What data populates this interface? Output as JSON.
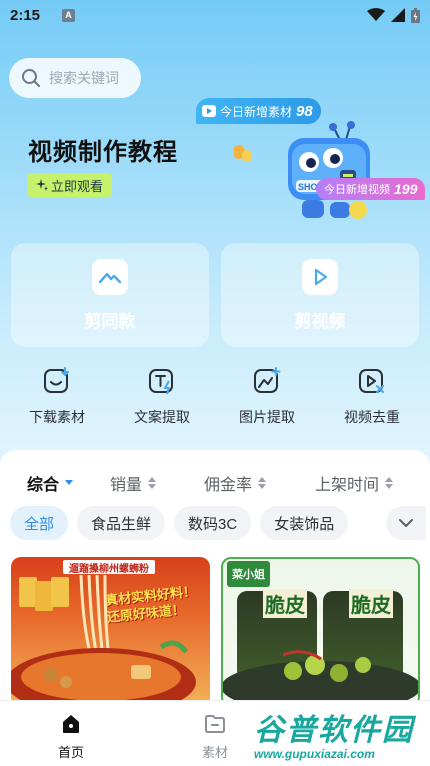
{
  "status_bar": {
    "time": "2:15",
    "notification_glyph": "A"
  },
  "search": {
    "placeholder": "搜索关键词"
  },
  "banner": {
    "title": "视频制作教程",
    "watch_button": "立即观看",
    "materials_label": "今日新增素材",
    "materials_count": "98",
    "videos_label": "今日新增视频",
    "videos_count": "199",
    "mascot_text": "SHOW"
  },
  "cards": [
    {
      "label": "剪同款",
      "icon": "mountain-icon"
    },
    {
      "label": "剪视频",
      "icon": "play-icon"
    }
  ],
  "tools": [
    {
      "label": "下载素材",
      "icon": "download-smile-icon"
    },
    {
      "label": "文案提取",
      "icon": "text-extract-icon"
    },
    {
      "label": "图片提取",
      "icon": "image-extract-icon"
    },
    {
      "label": "视频去重",
      "icon": "video-dedupe-icon"
    }
  ],
  "sort": [
    {
      "label": "综合",
      "active": true
    },
    {
      "label": "销量",
      "active": false
    },
    {
      "label": "佣金率",
      "active": false
    },
    {
      "label": "上架时间",
      "active": false
    }
  ],
  "categories": [
    {
      "label": "全部",
      "active": true
    },
    {
      "label": "食品生鲜",
      "active": false
    },
    {
      "label": "数码3C",
      "active": false
    },
    {
      "label": "女装饰品",
      "active": false
    }
  ],
  "products": [
    {
      "banner": "遛蹓搡柳州螺蛳粉",
      "slogan": "真材实料好料！还原好味道！"
    },
    {
      "brand": "菜小姐",
      "label": "脆皮"
    }
  ],
  "nav": [
    {
      "label": "首页",
      "active": true
    },
    {
      "label": "素材",
      "active": false
    }
  ],
  "watermark": {
    "main": "谷普软件园",
    "url": "www.gupuxiazai.com"
  },
  "colors": {
    "accent": "#2e8de6",
    "hero_top": "#74cbf6",
    "watch_button": "#c5f26a"
  }
}
